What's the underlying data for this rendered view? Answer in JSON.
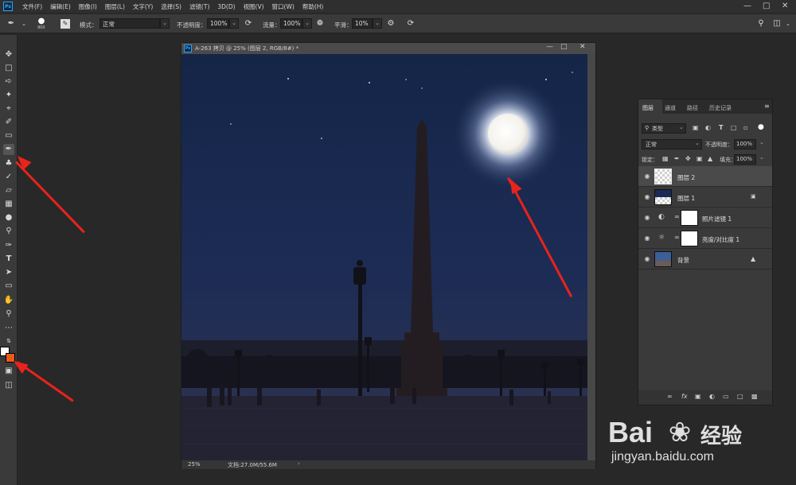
{
  "app": {
    "logo": "Ps"
  },
  "menubar": {
    "items": [
      "文件(F)",
      "编辑(E)",
      "图像(I)",
      "图层(L)",
      "文字(Y)",
      "选择(S)",
      "滤镜(T)",
      "3D(D)",
      "视图(V)",
      "窗口(W)",
      "帮助(H)"
    ]
  },
  "options": {
    "brush_size": "900",
    "mode_label": "模式：",
    "mode_value": "正常",
    "opacity_label": "不透明度：",
    "opacity_value": "100%",
    "flow_label": "流量：",
    "flow_value": "100%",
    "smooth_label": "平滑：",
    "smooth_value": "10%"
  },
  "document": {
    "title": "A-263 拷贝 @ 25% (图层 2, RGB/8#) *",
    "zoom": "25%",
    "doc_info": "文档:27.0M/55.6M"
  },
  "layers_panel": {
    "tabs": [
      "图层",
      "通道",
      "路径",
      "历史记录"
    ],
    "filter_kind": "类型",
    "blend_mode": "正常",
    "opacity_label": "不透明度：",
    "opacity_value": "100%",
    "lock_label": "锁定：",
    "fill_label": "填充：",
    "fill_value": "100%",
    "layers": [
      {
        "name": "图层 2",
        "selected": true
      },
      {
        "name": "图层 1",
        "selected": false
      },
      {
        "name": "照片滤镜 1",
        "selected": false
      },
      {
        "name": "亮度/对比度 1",
        "selected": false
      },
      {
        "name": "背景",
        "selected": false
      }
    ]
  },
  "watermark": {
    "brand": "Bai",
    "brand_cn": "经验",
    "url": "jingyan.baidu.com"
  },
  "colors": {
    "accent": "#2fa3f5",
    "annotation": "#e8231c",
    "night_sky": "#1a2748"
  }
}
